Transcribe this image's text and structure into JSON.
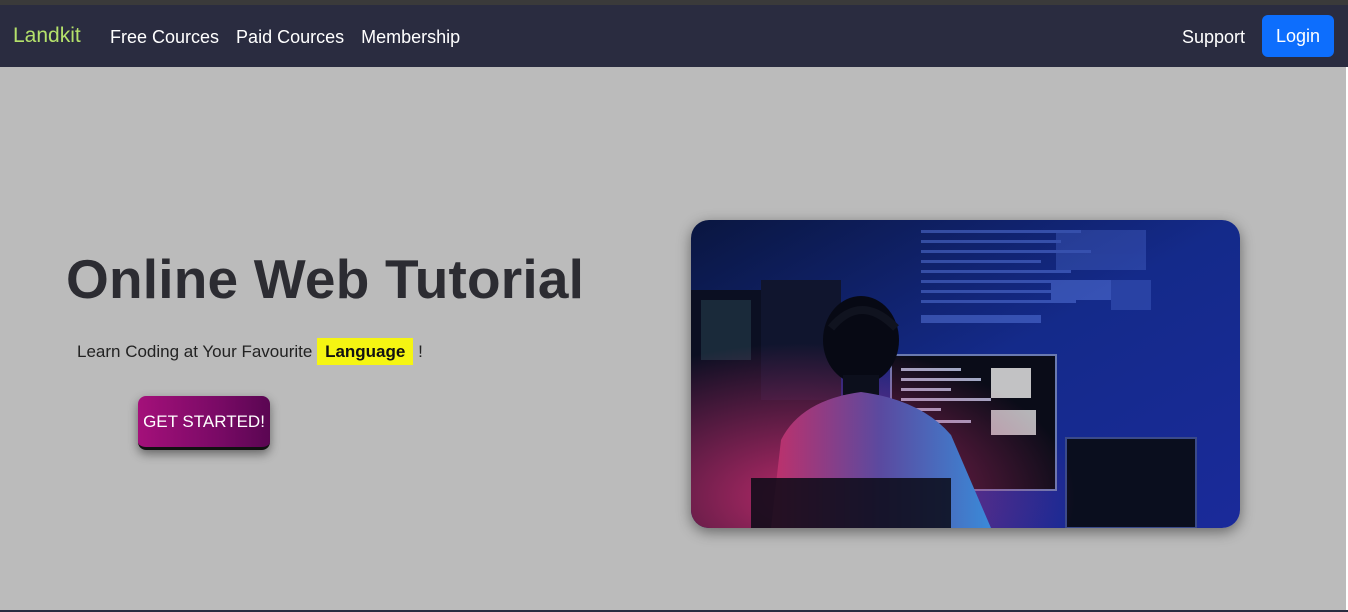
{
  "navbar": {
    "brand": "Landkit",
    "links": [
      "Free Cources",
      "Paid Cources",
      "Membership"
    ],
    "support": "Support",
    "login": "Login"
  },
  "hero": {
    "title": "Online Web Tutorial",
    "tagline_prefix": "Learn Coding at Your Favourite",
    "tagline_highlight": "Language",
    "tagline_suffix": "!",
    "cta": "GET STARTED!",
    "image_icon": "developer-at-computer-image"
  },
  "colors": {
    "navbar_bg": "#2a2c40",
    "brand": "#b4e16b",
    "login_bg": "#0d6efd",
    "page_bg": "#bbbbbb",
    "highlight": "#f5f512",
    "cta_gradient_start": "#a4107a",
    "cta_gradient_end": "#5a0652"
  }
}
